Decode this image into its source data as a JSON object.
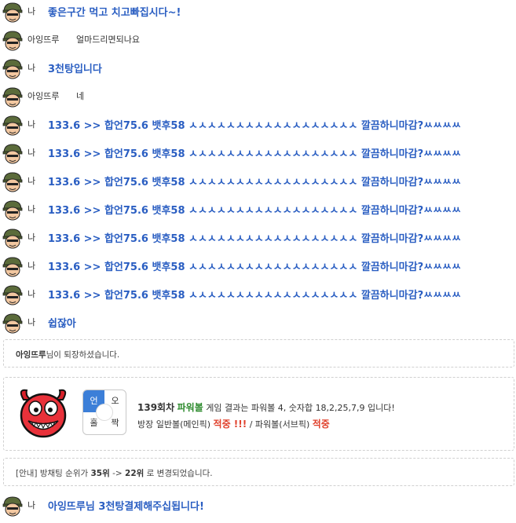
{
  "self_name": "나",
  "messages": [
    {
      "who": "me",
      "name": "나",
      "text": "좋은구간 먹고 치고빠집시다~!"
    },
    {
      "who": "other",
      "name": "아잉뜨루",
      "text": "얼마드리면되나요"
    },
    {
      "who": "me",
      "name": "나",
      "text": "3천탕입니다"
    },
    {
      "who": "other",
      "name": "아잉뜨루",
      "text": "네"
    },
    {
      "who": "me",
      "name": "나",
      "text": "133.6 >> 합언75.6 뱃후58 ㅅㅅㅅㅅㅅㅅㅅㅅㅅㅅㅅㅅㅅㅅㅅㅅㅅㅅ 깔끔하니마감?ㅆㅆㅆㅆ"
    },
    {
      "who": "me",
      "name": "나",
      "text": "133.6 >> 합언75.6 뱃후58 ㅅㅅㅅㅅㅅㅅㅅㅅㅅㅅㅅㅅㅅㅅㅅㅅㅅㅅ 깔끔하니마감?ㅆㅆㅆㅆ"
    },
    {
      "who": "me",
      "name": "나",
      "text": "133.6 >> 합언75.6 뱃후58 ㅅㅅㅅㅅㅅㅅㅅㅅㅅㅅㅅㅅㅅㅅㅅㅅㅅㅅ 깔끔하니마감?ㅆㅆㅆㅆ"
    },
    {
      "who": "me",
      "name": "나",
      "text": "133.6 >> 합언75.6 뱃후58 ㅅㅅㅅㅅㅅㅅㅅㅅㅅㅅㅅㅅㅅㅅㅅㅅㅅㅅ 깔끔하니마감?ㅆㅆㅆㅆ"
    },
    {
      "who": "me",
      "name": "나",
      "text": "133.6 >> 합언75.6 뱃후58 ㅅㅅㅅㅅㅅㅅㅅㅅㅅㅅㅅㅅㅅㅅㅅㅅㅅㅅ 깔끔하니마감?ㅆㅆㅆㅆ"
    },
    {
      "who": "me",
      "name": "나",
      "text": "133.6 >> 합언75.6 뱃후58 ㅅㅅㅅㅅㅅㅅㅅㅅㅅㅅㅅㅅㅅㅅㅅㅅㅅㅅ 깔끔하니마감?ㅆㅆㅆㅆ"
    },
    {
      "who": "me",
      "name": "나",
      "text": "133.6 >> 합언75.6 뱃후58 ㅅㅅㅅㅅㅅㅅㅅㅅㅅㅅㅅㅅㅅㅅㅅㅅㅅㅅ 깔끔하니마감?ㅆㅆㅆㅆ"
    },
    {
      "who": "me",
      "name": "나",
      "text": "쉽잖아"
    }
  ],
  "exit_notice": {
    "user": "아잉뜨루",
    "suffix": "님이 퇴장하셨습니다."
  },
  "result": {
    "board": {
      "tl": "언",
      "tr": "오",
      "bl": "홀",
      "br": "짝",
      "active": "언"
    },
    "round": "139회차",
    "game": "파워볼",
    "line1_rest": "게임 결과는 파워볼 4, 숫자합 18,2,25,7,9 입니다!",
    "line2_a": "방장 일반볼(메인픽)",
    "line2_hit1": "적중 !!!",
    "line2_b": "/ 파워볼(서브픽)",
    "line2_hit2": "적중"
  },
  "rank_notice": {
    "prefix": "[안내] 방채팅 순위가 ",
    "from": "35위",
    "arrow": " -> ",
    "to": "22위",
    "suffix": " 로 변경되었습니다."
  },
  "final_message": {
    "name": "나",
    "text": "아잉뜨루님 3천탕결제해주십됩니다!"
  },
  "colors": {
    "me_text": "#2a5ec2",
    "hit": "#e0412c",
    "game": "#2e8b2e",
    "board_active": "#3c7fd8"
  }
}
